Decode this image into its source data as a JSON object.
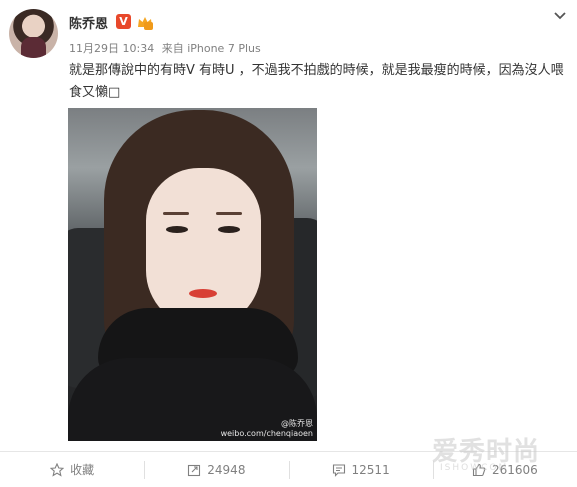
{
  "post": {
    "author": "陈乔恩",
    "verified_badge": "V",
    "date": "11月29日 10:34",
    "source": "来自 iPhone 7 Plus",
    "text": "就是那傳說中的有時V 有時U ，不過我不拍戲的時候，就是我最瘦的時候，因為沒人喂食又懶□",
    "photo_watermark": "@陈乔恩\nweibo.com/chenqiaoen"
  },
  "actions": {
    "favorite_label": "收藏",
    "repost_count": "24948",
    "comment_count": "12511",
    "like_count": "261606"
  },
  "site_watermark": {
    "title": "爱秀时尚",
    "subtitle": "ISHOWCOM"
  },
  "colors": {
    "verified": "#e8482b",
    "meta": "#808080",
    "text": "#333333"
  },
  "icons": [
    "chevron-down-icon",
    "star-icon",
    "repost-icon",
    "comment-icon",
    "like-icon",
    "member-icon"
  ]
}
